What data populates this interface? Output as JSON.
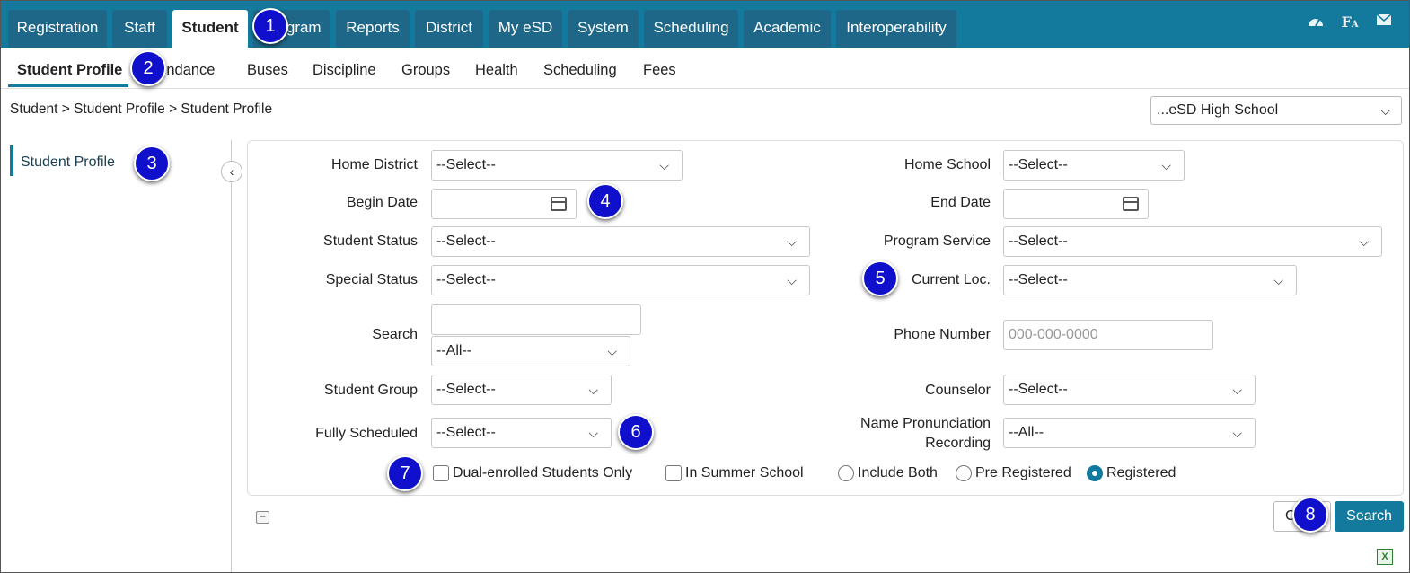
{
  "top_tabs": [
    "Registration",
    "Staff",
    "Student",
    "Program",
    "Reports",
    "District",
    "My eSD",
    "System",
    "Scheduling",
    "Academic",
    "Interoperability"
  ],
  "top_icons": [
    "dashboard-icon",
    "font-icon",
    "mail-icon"
  ],
  "sub_tabs": [
    "Student Profile",
    "Attendance",
    "Buses",
    "Discipline",
    "Groups",
    "Health",
    "Scheduling",
    "Fees"
  ],
  "breadcrumb": "Student > Student Profile > Student Profile",
  "school_select": "...eSD High School",
  "side_panel": {
    "item": "Student Profile",
    "collapse_icon": "‹"
  },
  "form": {
    "home_district": {
      "label": "Home District",
      "value": "--Select--"
    },
    "home_school": {
      "label": "Home School",
      "value": "--Select--"
    },
    "begin_date": {
      "label": "Begin Date",
      "value": ""
    },
    "end_date": {
      "label": "End Date",
      "value": ""
    },
    "student_status": {
      "label": "Student Status",
      "value": "--Select--"
    },
    "program_service": {
      "label": "Program Service",
      "value": "--Select--"
    },
    "special_status": {
      "label": "Special Status",
      "value": "--Select--"
    },
    "current_loc": {
      "label": "Current Loc.",
      "value": "--Select--"
    },
    "search": {
      "label": "Search",
      "value": "",
      "filter": "--All--"
    },
    "phone_number": {
      "label": "Phone Number",
      "placeholder": "000-000-0000"
    },
    "student_group": {
      "label": "Student Group",
      "value": "--Select--"
    },
    "counselor": {
      "label": "Counselor",
      "value": "--Select--"
    },
    "fully_scheduled": {
      "label": "Fully Scheduled",
      "value": "--Select--"
    },
    "name_pronunciation": {
      "label_line1": "Name Pronunciation",
      "label_line2": "Recording",
      "value": "--All--"
    },
    "dual_enrolled": {
      "label": "Dual-enrolled Students Only",
      "checked": false
    },
    "summer_school": {
      "label": "In Summer School",
      "checked": false
    },
    "radio_options": [
      {
        "label": "Include Both",
        "checked": false
      },
      {
        "label": "Pre Registered",
        "checked": false
      },
      {
        "label": "Registered",
        "checked": true
      }
    ]
  },
  "buttons": {
    "clear": "Clear",
    "search": "Search",
    "collapse": "−"
  },
  "callouts": [
    "1",
    "2",
    "3",
    "4",
    "5",
    "6",
    "7",
    "8"
  ],
  "colors": {
    "nav_bar": "#137a9e",
    "tab_inactive": "#1e6788",
    "callout": "#1010cc",
    "primary_button": "#137a9e"
  }
}
